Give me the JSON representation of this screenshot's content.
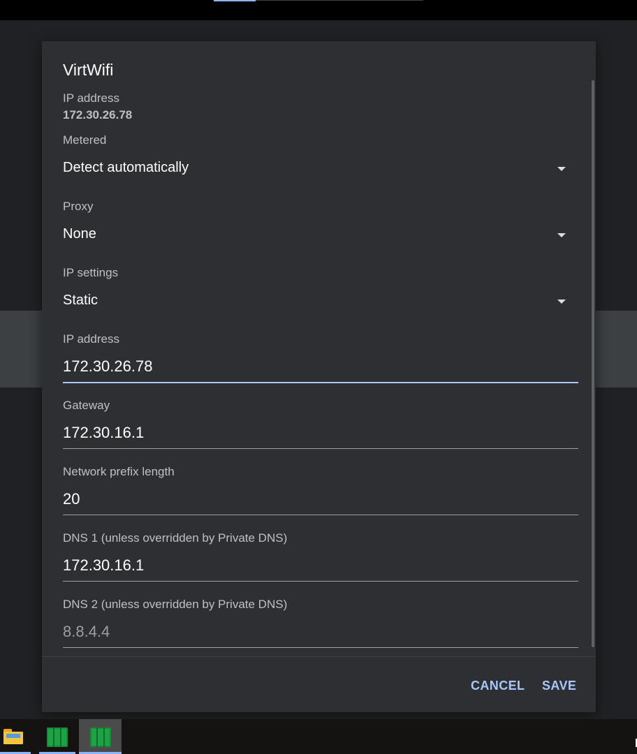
{
  "dialog": {
    "title": "VirtWifi",
    "info": {
      "label": "IP address",
      "value": "172.30.26.78"
    },
    "metered": {
      "label": "Metered",
      "value": "Detect automatically"
    },
    "proxy": {
      "label": "Proxy",
      "value": "None"
    },
    "ip_settings": {
      "label": "IP settings",
      "value": "Static"
    },
    "ip_address": {
      "label": "IP address",
      "value": "172.30.26.78"
    },
    "gateway": {
      "label": "Gateway",
      "value": "172.30.16.1"
    },
    "prefix_length": {
      "label": "Network prefix length",
      "value": "20"
    },
    "dns1": {
      "label": "DNS 1 (unless overridden by Private DNS)",
      "value": "172.30.16.1"
    },
    "dns2": {
      "label": "DNS 2 (unless overridden by Private DNS)",
      "placeholder": "8.8.4.4"
    },
    "cancel_label": "CANCEL",
    "save_label": "SAVE"
  },
  "colors": {
    "accent": "#a8c7fa",
    "dialog_bg": "#2d2f32",
    "taskbar_indicator": "#8ab4f8"
  },
  "taskbar": {
    "items": [
      {
        "icon": "file-explorer-icon"
      },
      {
        "icon": "app-cube-icon"
      },
      {
        "icon": "app-cube-icon"
      }
    ]
  }
}
